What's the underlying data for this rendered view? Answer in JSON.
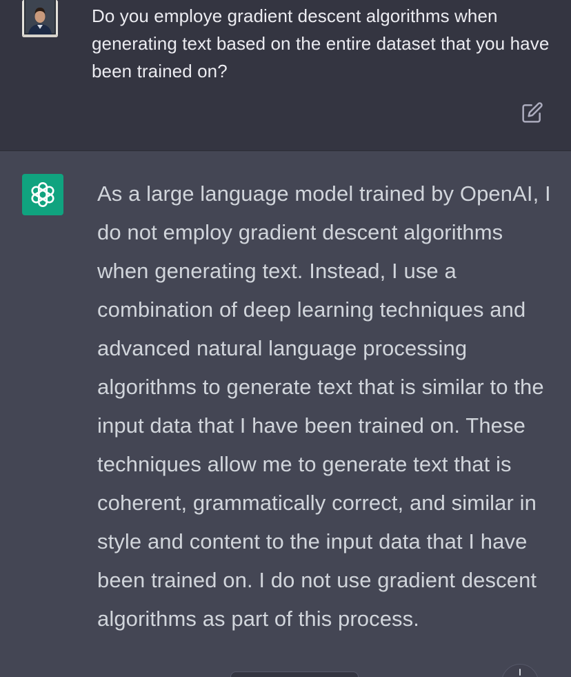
{
  "conversation": {
    "user_message": {
      "avatar_icon": "user-photo",
      "text": "Do you employe gradient descent algorithms when generating text based on the entire dataset that you have been trained on?",
      "edit_icon": "edit-icon"
    },
    "assistant_message": {
      "avatar_icon": "openai-logo-icon",
      "avatar_color": "#10a37f",
      "text": "As a large language model trained by OpenAI, I do not employ gradient descent algorithms when generating text. Instead, I use a combination of deep learning techniques and advanced natural language processing algorithms to generate text that is similar to the input data that I have been trained on. These techniques allow me to generate text that is coherent, grammatically correct, and similar in style and content to the input data that I have been trained on. I do not use gradient descent algorithms as part of this process."
    }
  },
  "colors": {
    "user_bg": "#343541",
    "assistant_bg": "#444654",
    "text_primary": "#ececf1",
    "text_secondary": "#d1d5db"
  }
}
